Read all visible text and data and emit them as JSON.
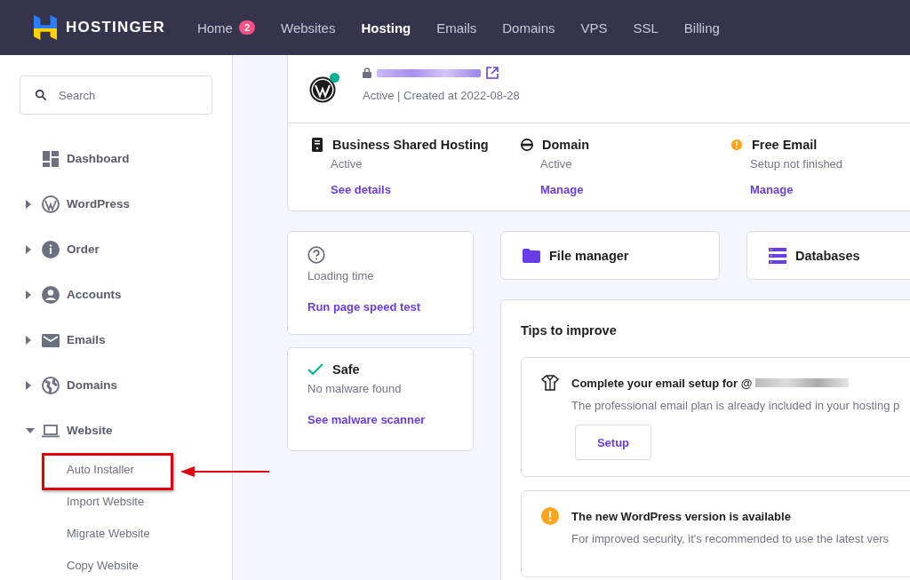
{
  "brand": {
    "name": "HOSTINGER"
  },
  "nav": [
    {
      "label": "Home",
      "badge": "2",
      "selected": false
    },
    {
      "label": "Websites",
      "selected": false
    },
    {
      "label": "Hosting",
      "selected": true
    },
    {
      "label": "Emails",
      "selected": false
    },
    {
      "label": "Domains",
      "selected": false
    },
    {
      "label": "VPS",
      "selected": false
    },
    {
      "label": "SSL",
      "selected": false
    },
    {
      "label": "Billing",
      "selected": false
    }
  ],
  "search": {
    "placeholder": "Search"
  },
  "sidebar": {
    "items": [
      {
        "label": "Dashboard",
        "kind": "dashboard"
      },
      {
        "label": "WordPress",
        "kind": "wordpress",
        "expanded": false
      },
      {
        "label": "Order",
        "kind": "info",
        "expanded": false
      },
      {
        "label": "Accounts",
        "kind": "account",
        "expanded": false
      },
      {
        "label": "Emails",
        "kind": "mail",
        "expanded": false
      },
      {
        "label": "Domains",
        "kind": "globe",
        "expanded": false
      },
      {
        "label": "Website",
        "kind": "laptop",
        "expanded": true,
        "children": [
          {
            "label": "Auto Installer",
            "annotated": true
          },
          {
            "label": "Import Website",
            "annotated": false
          },
          {
            "label": "Migrate Website",
            "annotated": false
          },
          {
            "label": "Copy Website",
            "annotated": false
          }
        ]
      }
    ]
  },
  "site": {
    "status": "Active | Created at 2022-08-28",
    "online": true
  },
  "services": [
    {
      "kind": "server",
      "title": "Business Shared Hosting",
      "status": "Active",
      "link": "See details"
    },
    {
      "kind": "www",
      "title": "Domain",
      "status": "Active",
      "link": "Manage"
    },
    {
      "kind": "warning",
      "title": "Free Email",
      "status": "Setup not finished",
      "link": "Manage"
    }
  ],
  "performance": {
    "label": "Loading time",
    "link": "Run page speed test"
  },
  "security": {
    "title": "Safe",
    "status": "No malware found",
    "link": "See malware scanner"
  },
  "shortcuts": [
    {
      "kind": "folder",
      "label": "File manager"
    },
    {
      "kind": "database",
      "label": "Databases"
    }
  ],
  "tips": {
    "title": "Tips to improve",
    "items": [
      {
        "kind": "shirt",
        "title": "Complete your email setup for @",
        "text": "The professional email plan is already included in your hosting p",
        "button": "Setup"
      },
      {
        "kind": "warning",
        "title": "The new WordPress version is available",
        "text": "For improved security, it's recommended to use the latest vers"
      }
    ]
  }
}
